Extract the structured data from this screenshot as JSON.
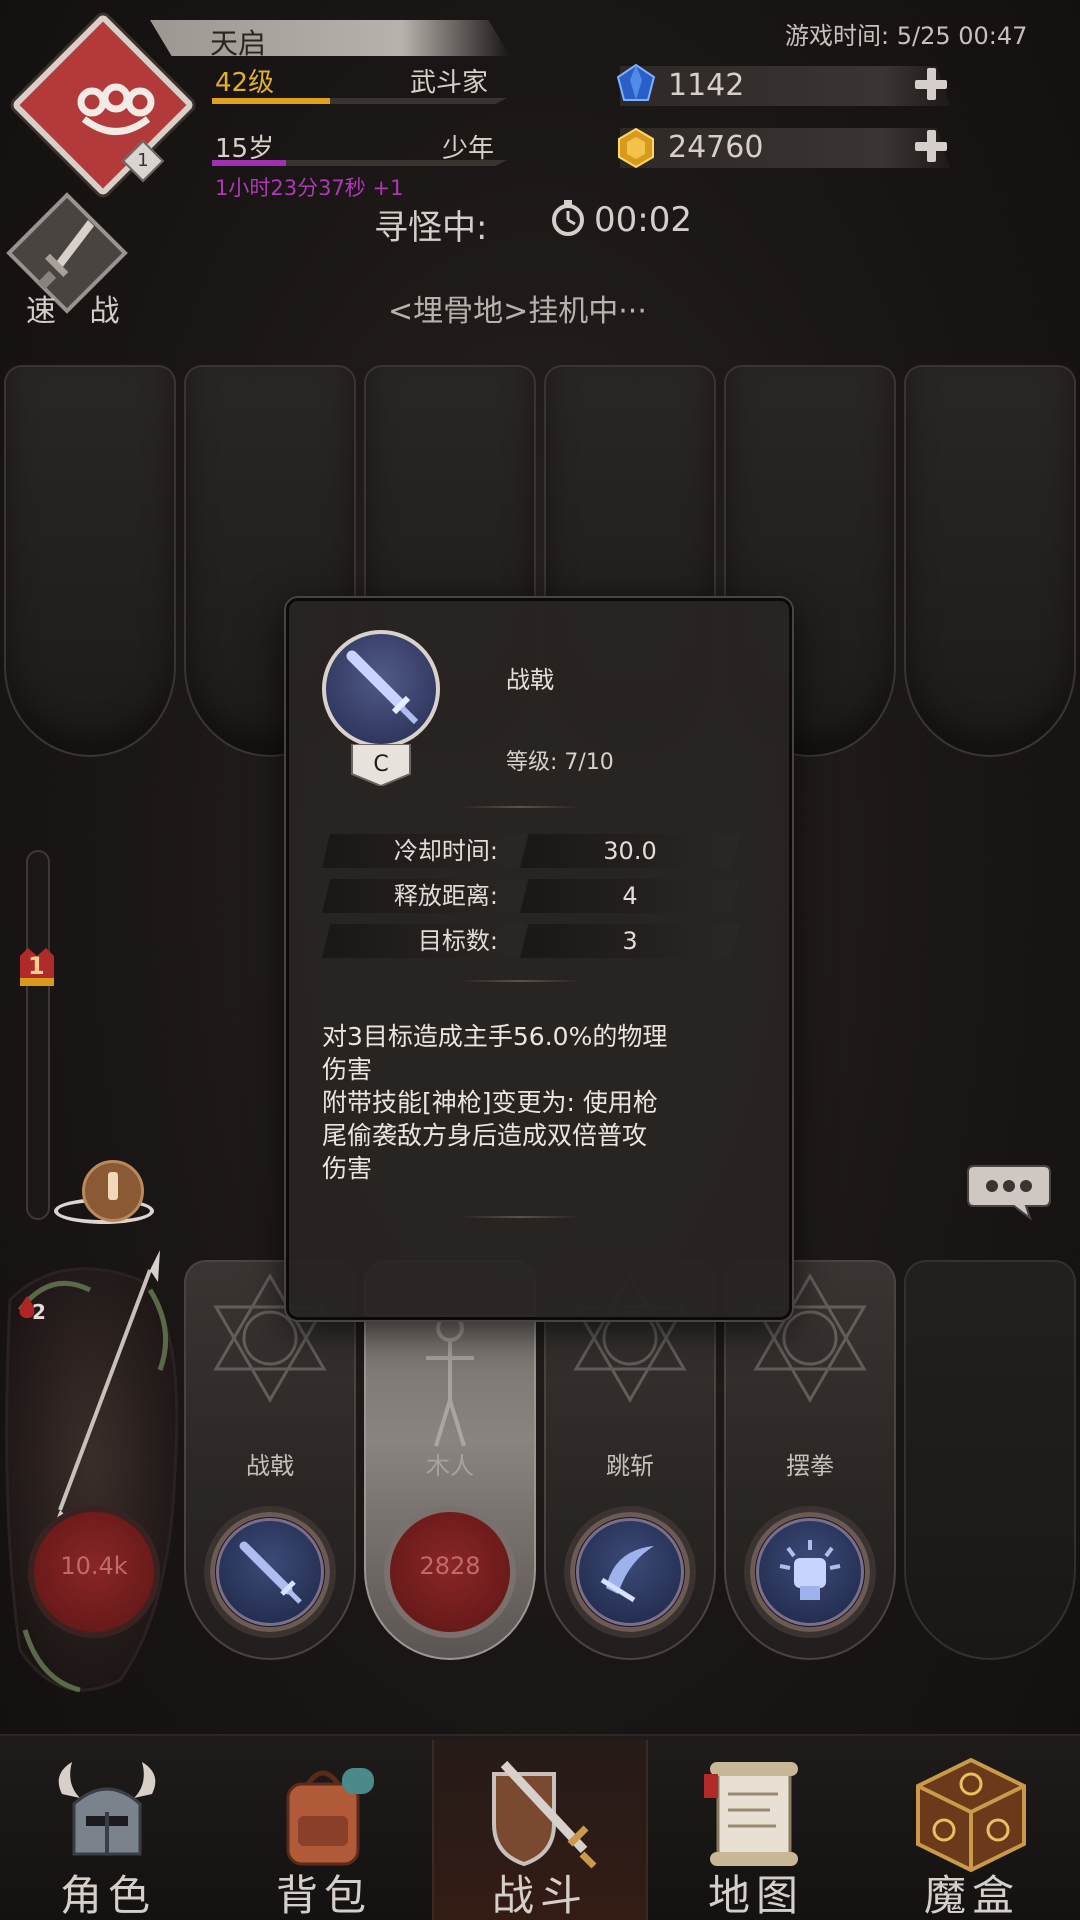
{
  "header": {
    "player_name": "天启",
    "level": "42级",
    "class_name": "武斗家",
    "age": "15岁",
    "life_stage": "少年",
    "age_timer": "1小时23分37秒 +1",
    "emblem_icon": "brass-knuckles-icon",
    "emblem_rank": "1",
    "game_time": "游戏时间: 5/25 00:47",
    "level_progress": 0.4,
    "age_progress": 0.25,
    "colors": {
      "level_bar": "#e0a020",
      "age_bar": "#a030b0",
      "emblem": "#b23a3a"
    }
  },
  "currencies": [
    {
      "name": "diamond",
      "icon": "blue-gem-icon",
      "value": "1142"
    },
    {
      "name": "gold",
      "icon": "gold-gem-icon",
      "value": "24760"
    }
  ],
  "search": {
    "label": "寻怪中:",
    "time": "00:02"
  },
  "quick_battle": {
    "label": "速 战",
    "icon": "sword-icon"
  },
  "status_line": "<埋骨地>挂机中···",
  "gauge": {
    "marker_value": "1"
  },
  "hero": {
    "hp_text": "10.4k",
    "blood_count": "2"
  },
  "skill_slots": [
    {
      "label": "战戟",
      "icon": "halberd-sword-icon",
      "type": "skill"
    },
    {
      "label": "木人",
      "hp_text": "2828",
      "type": "dummy"
    },
    {
      "label": "跳斩",
      "icon": "leap-slash-icon",
      "type": "skill"
    },
    {
      "label": "摆拳",
      "icon": "fist-icon",
      "type": "skill"
    }
  ],
  "tooltip": {
    "skill_name": "战戟",
    "grade": "C",
    "level": "等级: 7/10",
    "stats": [
      {
        "key": "冷却时间:",
        "value": "30.0"
      },
      {
        "key": "释放距离:",
        "value": "4"
      },
      {
        "key": "目标数:",
        "value": "3"
      }
    ],
    "description": [
      "对3目标造成主手56.0%的物理",
      "伤害",
      "附带技能[神枪]变更为: 使用枪",
      "尾偷袭敌方身后造成双倍普攻",
      "伤害"
    ]
  },
  "nav": [
    {
      "label": "角色",
      "icon": "horned-helmet-icon"
    },
    {
      "label": "背包",
      "icon": "backpack-icon"
    },
    {
      "label": "战斗",
      "icon": "sword-shield-icon",
      "active": true
    },
    {
      "label": "地图",
      "icon": "scroll-map-icon"
    },
    {
      "label": "魔盒",
      "icon": "magic-cube-icon"
    }
  ]
}
